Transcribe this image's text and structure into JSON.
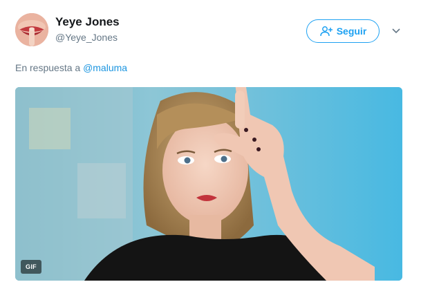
{
  "author": {
    "display_name": "Yeye Jones",
    "screen_name": "@Yeye_Jones",
    "avatar_icon": "avatar-image"
  },
  "header": {
    "follow_label": "Seguir",
    "follow_icon": "add-user-icon",
    "more_icon": "chevron-down-icon",
    "accent_color": "#1da1f2"
  },
  "reply": {
    "prefix": "En respuesta a ",
    "mention": "@maluma"
  },
  "media": {
    "type": "gif",
    "badge": "GIF",
    "description_icon": "gif-media-image"
  }
}
